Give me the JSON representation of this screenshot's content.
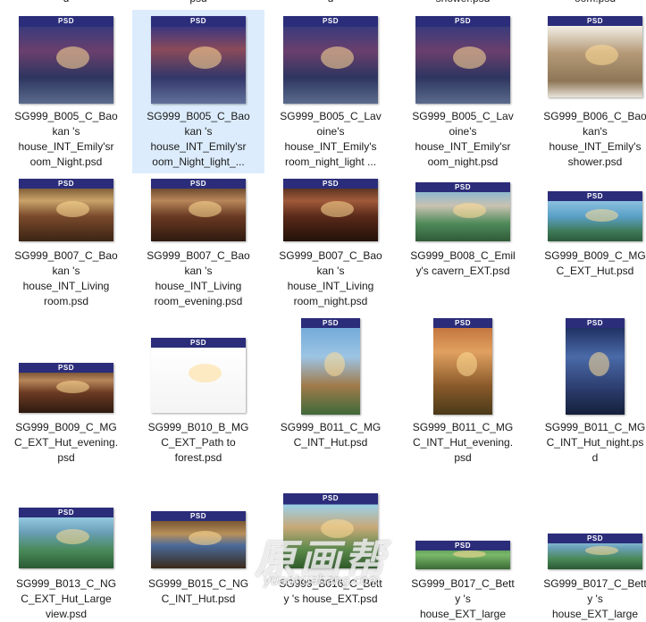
{
  "thumb_badge": "PSD",
  "top_partial": [
    "d",
    "psd",
    "d",
    "shower.psd",
    "oom.psd"
  ],
  "files": [
    {
      "name": "SG999_B005_C_Baokan 's house_INT_Emily'sroom_Night.psd",
      "lines": [
        "SG999_B005_C_Bao",
        "kan 's",
        "house_INT_Emily'sr",
        "oom_Night.psd"
      ],
      "selected": false
    },
    {
      "name": "SG999_B005_C_Baokan 's house_INT_Emily'sroom_Night_light...",
      "lines": [
        "SG999_B005_C_Bao",
        "kan 's",
        "house_INT_Emily'sr",
        "oom_Night_light_..."
      ],
      "selected": true
    },
    {
      "name": "SG999_B005_C_Lavoine's house_INT_Emily's room_night_light ...",
      "lines": [
        "SG999_B005_C_Lav",
        "oine's",
        "house_INT_Emily's",
        "room_night_light ..."
      ],
      "selected": false
    },
    {
      "name": "SG999_B005_C_Lavoine's house_INT_Emily'sroom_night.psd",
      "lines": [
        "SG999_B005_C_Lav",
        "oine's",
        "house_INT_Emily'sr",
        "oom_night.psd"
      ],
      "selected": false
    },
    {
      "name": "SG999_B006_C_Baokan's house_INT_Emily's shower.psd",
      "lines": [
        "SG999_B006_C_Bao",
        "kan's",
        "house_INT_Emily's",
        "shower.psd"
      ],
      "selected": false
    },
    {
      "name": "SG999_B007_C_Baokan 's house_INT_Living room.psd",
      "lines": [
        "SG999_B007_C_Bao",
        "kan 's",
        "house_INT_Living",
        "room.psd"
      ],
      "selected": false
    },
    {
      "name": "SG999_B007_C_Baokan 's house_INT_Living room_evening.psd",
      "lines": [
        "SG999_B007_C_Bao",
        "kan 's",
        "house_INT_Living",
        "room_evening.psd"
      ],
      "selected": false
    },
    {
      "name": "SG999_B007_C_Baokan 's house_INT_Living room_night.psd",
      "lines": [
        "SG999_B007_C_Bao",
        "kan 's",
        "house_INT_Living",
        "room_night.psd"
      ],
      "selected": false
    },
    {
      "name": "SG999_B008_C_Emily's cavern_EXT.psd",
      "lines": [
        "SG999_B008_C_Emil",
        "y's cavern_EXT.psd"
      ],
      "selected": false
    },
    {
      "name": "SG999_B009_C_MGC_EXT_Hut.psd",
      "lines": [
        "SG999_B009_C_MG",
        "C_EXT_Hut.psd"
      ],
      "selected": false
    },
    {
      "name": "SG999_B009_C_MGC_EXT_Hut_evening.psd",
      "lines": [
        "SG999_B009_C_MG",
        "C_EXT_Hut_evening.",
        "psd"
      ],
      "selected": false
    },
    {
      "name": "SG999_B010_B_MGC_EXT_Path to forest.psd",
      "lines": [
        "SG999_B010_B_MG",
        "C_EXT_Path to",
        "forest.psd"
      ],
      "selected": false
    },
    {
      "name": "SG999_B011_C_MGC_INT_Hut.psd",
      "lines": [
        "SG999_B011_C_MG",
        "C_INT_Hut.psd"
      ],
      "selected": false
    },
    {
      "name": "SG999_B011_C_MGC_INT_Hut_evening.psd",
      "lines": [
        "SG999_B011_C_MG",
        "C_INT_Hut_evening.",
        "psd"
      ],
      "selected": false
    },
    {
      "name": "SG999_B011_C_MGC_INT_Hut_night.psd",
      "lines": [
        "SG999_B011_C_MG",
        "C_INT_Hut_night.ps",
        "d"
      ],
      "selected": false
    },
    {
      "name": "SG999_B013_C_NGC_EXT_Hut_Large view.psd",
      "lines": [
        "SG999_B013_C_NG",
        "C_EXT_Hut_Large",
        "view.psd"
      ],
      "selected": false
    },
    {
      "name": "SG999_B015_C_NGC_INT_Hut.psd",
      "lines": [
        "SG999_B015_C_NG",
        "C_INT_Hut.psd"
      ],
      "selected": false
    },
    {
      "name": "SG999_B016_C_Betty's house_EXT.psd",
      "lines": [
        "SG999_B016_C_Bett",
        "y 's house_EXT.psd"
      ],
      "selected": false
    },
    {
      "name": "SG999_B017_C_Betty 's house_EXT_large",
      "lines": [
        "SG999_B017_C_Bett",
        "y 's",
        "house_EXT_large"
      ],
      "selected": false
    },
    {
      "name": "SG999_B017_C_Betty 's house_EXT_large",
      "lines": [
        "SG999_B017_C_Bett",
        "y 's",
        "house_EXT_large"
      ],
      "selected": false
    }
  ],
  "watermark": {
    "big": "原画帮",
    "url": "yuanhuabang.com"
  }
}
